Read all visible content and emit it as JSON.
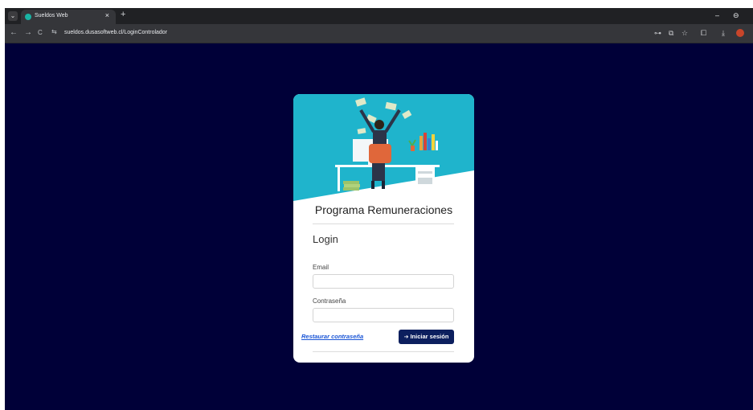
{
  "browser": {
    "tab": {
      "title": "Sueldos Web",
      "close": "×",
      "new_tab": "+"
    },
    "tab_menu": "⌄",
    "window_controls": {
      "minimize": "–",
      "restore": "⊖"
    },
    "nav": {
      "back": "←",
      "forward": "→",
      "reload": "C"
    },
    "url": "sueldos.dusasoftweb.cl/LoginControlador",
    "site_info_icon": "⇆",
    "toolbar_icons": {
      "key": "⊶",
      "share": "⧉",
      "star": "☆",
      "extensions": "⧠",
      "download": "⤓"
    }
  },
  "login": {
    "app_title": "Programa Remuneraciones",
    "heading": "Login",
    "email_label": "Email",
    "email_value": "",
    "password_label": "Contraseña",
    "password_value": "",
    "restore_link": "Restaurar contraseña",
    "submit_icon": "➔",
    "submit_label": "Iniciar sesión"
  },
  "colors": {
    "page_background": "#000038",
    "hero_teal": "#1fb4cc",
    "button": "#0c1f5e",
    "link": "#1a55d6"
  }
}
